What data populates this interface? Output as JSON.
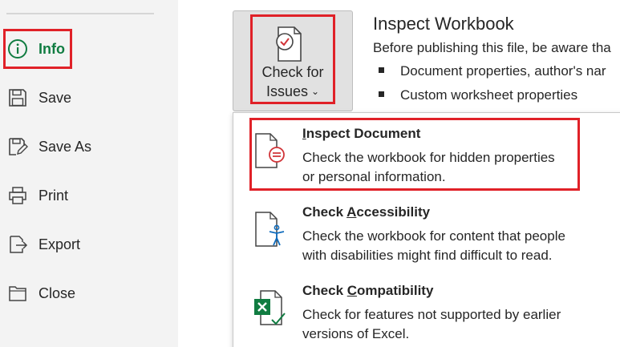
{
  "nav": {
    "items": [
      {
        "label": "Info",
        "icon": "info-icon",
        "active": true
      },
      {
        "label": "Save",
        "icon": "save-icon"
      },
      {
        "label": "Save As",
        "icon": "save-as-icon"
      },
      {
        "label": "Print",
        "icon": "print-icon"
      },
      {
        "label": "Export",
        "icon": "export-icon"
      },
      {
        "label": "Close",
        "icon": "close-folder-icon"
      }
    ]
  },
  "check_for_issues": {
    "line1": "Check for",
    "line2": "Issues",
    "icon": "document-check-icon"
  },
  "inspect": {
    "title": "Inspect Workbook",
    "description": "Before publishing this file, be aware tha",
    "bullets": [
      "Document properties, author's nar",
      "Custom worksheet properties"
    ]
  },
  "menu": {
    "items": [
      {
        "title_pre": "",
        "title_u": "I",
        "title_post": "nspect Document",
        "line1": "Check the workbook for hidden properties",
        "line2": "or personal information.",
        "icon": "inspect-document-icon"
      },
      {
        "title_pre": "Check ",
        "title_u": "A",
        "title_post": "ccessibility",
        "line1": "Check the workbook for content that people",
        "line2": "with disabilities might find difficult to read.",
        "icon": "accessibility-icon"
      },
      {
        "title_pre": "Check ",
        "title_u": "C",
        "title_post": "ompatibility",
        "line1": "Check for features not supported by earlier",
        "line2": "versions of Excel.",
        "icon": "excel-compatibility-icon"
      }
    ]
  },
  "colors": {
    "accent": "#107c41",
    "highlight": "#e02128",
    "nav_bg": "#f3f3f3"
  }
}
